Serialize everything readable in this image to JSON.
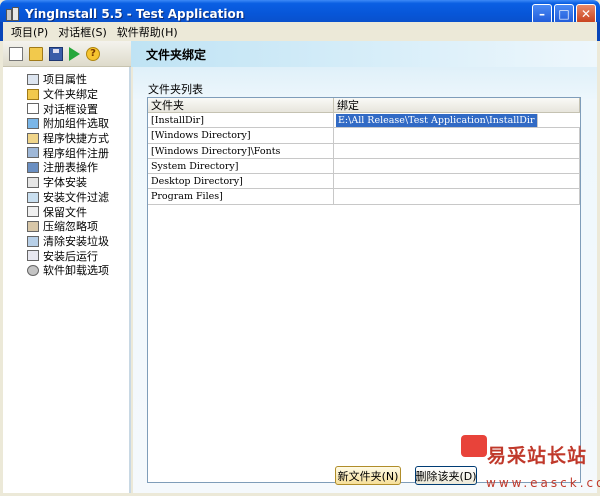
{
  "window": {
    "title": "YingInstall 5.5 - Test Application"
  },
  "menu": [
    "项目(P)",
    "对话框(S)",
    "软件帮助(H)"
  ],
  "toolbar": [
    "new-icon",
    "open-icon",
    "save-icon",
    "run-icon",
    "help-icon"
  ],
  "header": {
    "title": "文件夹绑定"
  },
  "sidebar": {
    "items": [
      {
        "label": "项目属性",
        "icon": "project-properties-icon"
      },
      {
        "label": "文件夹绑定",
        "icon": "folder-icon"
      },
      {
        "label": "对话框设置",
        "icon": "dialog-icon"
      },
      {
        "label": "附加组件选取",
        "icon": "addon-icon"
      },
      {
        "label": "程序快捷方式",
        "icon": "shortcut-icon"
      },
      {
        "label": "程序组件注册",
        "icon": "register-icon"
      },
      {
        "label": "注册表操作",
        "icon": "registry-icon"
      },
      {
        "label": "字体安装",
        "icon": "font-icon"
      },
      {
        "label": "安装文件过滤",
        "icon": "filter-icon"
      },
      {
        "label": "保留文件",
        "icon": "keep-file-icon"
      },
      {
        "label": "压缩忽略项",
        "icon": "compress-icon"
      },
      {
        "label": "清除安装垃圾",
        "icon": "cleanup-icon"
      },
      {
        "label": "安装后运行",
        "icon": "run-after-icon"
      },
      {
        "label": "软件卸载选项",
        "icon": "uninstall-icon"
      }
    ]
  },
  "main": {
    "group_label": "文件夹列表",
    "columns": [
      "文件夹",
      "绑定"
    ],
    "rows": [
      [
        "[InstallDir]",
        "E:\\All Release\\Test Application\\InstallDir"
      ],
      [
        "[Windows Directory]",
        ""
      ],
      [
        "[Windows Directory]\\Fonts",
        ""
      ],
      [
        " System Directory]",
        ""
      ],
      [
        " Desktop Directory]",
        ""
      ],
      [
        " Program Files]",
        ""
      ]
    ],
    "new_folder_button": "新文件夹(N)",
    "delete_button": "删除该夹(D)"
  },
  "watermark": {
    "logo": "易采站长站",
    "url": "www.easck.com"
  },
  "colors": {
    "title_blue": "#0756d8",
    "selection": "#316ac5",
    "banner": "#bfe3f4"
  }
}
